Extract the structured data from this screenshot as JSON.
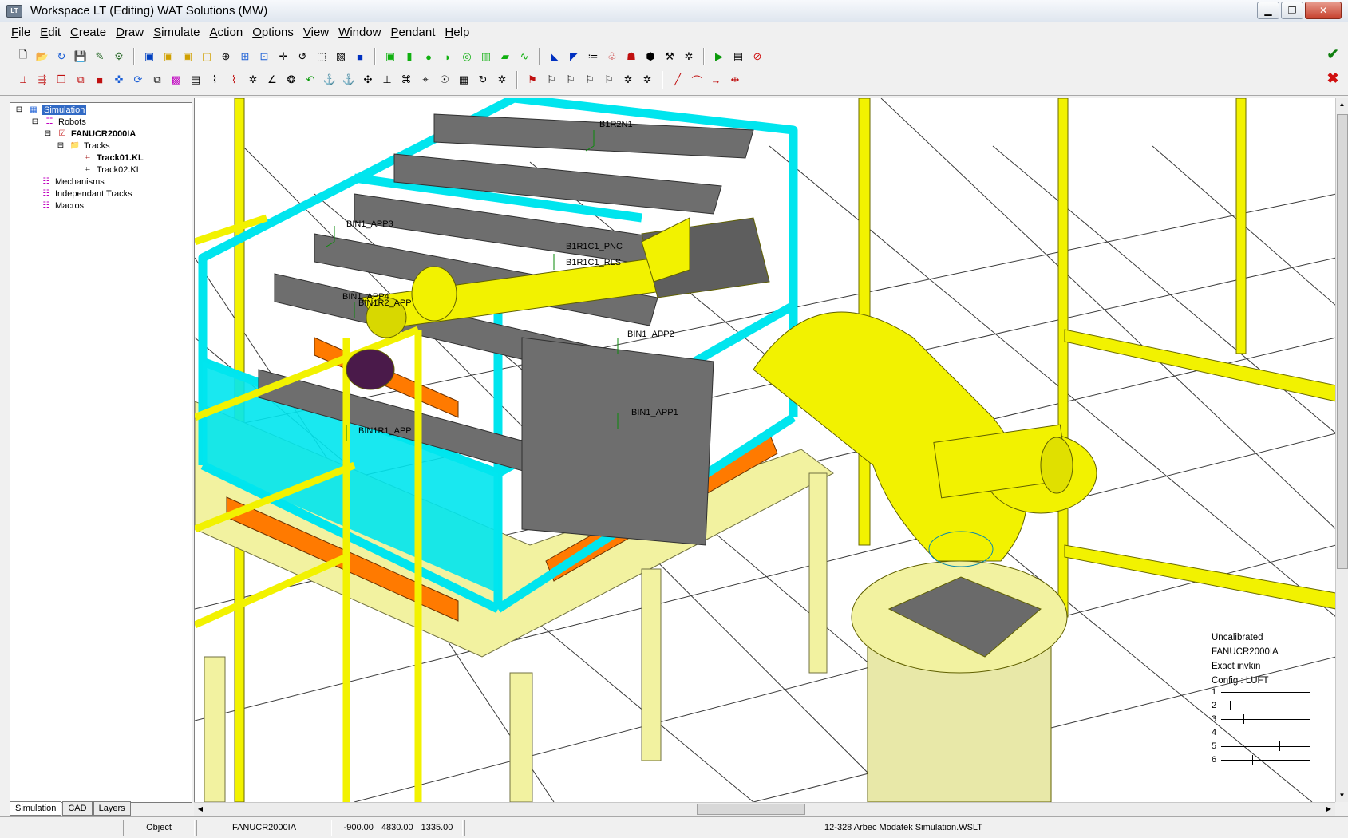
{
  "window": {
    "title": "Workspace LT  (Editing) WAT Solutions (MW)",
    "app_icon": "LT"
  },
  "menu": [
    "File",
    "Edit",
    "Create",
    "Draw",
    "Simulate",
    "Action",
    "Options",
    "View",
    "Window",
    "Pendant",
    "Help"
  ],
  "tree": {
    "root": "Simulation",
    "robots": "Robots",
    "robot": "FANUCR2000IA",
    "tracks": "Tracks",
    "track1": "Track01.KL",
    "track2": "Track02.KL",
    "mechanisms": "Mechanisms",
    "independent": "Independant Tracks",
    "macros": "Macros"
  },
  "tabs": [
    "Simulation",
    "CAD",
    "Layers"
  ],
  "viewport_labels": {
    "b1r2n1": "B1R2N1",
    "bin1_app3": "BIN1_APP3",
    "b1r1c1_pnc": "B1R1C1_PNC",
    "b1r1c1_rls": "B1R1C1_RLS",
    "bin1_app4": "BIN1_APP4",
    "bin1r2_app": "BIN1R2_APP",
    "bin1_app2": "BIN1_APP2",
    "bin1_app1": "BIN1_APP1",
    "bin1r1_app": "BIN1R1_APP"
  },
  "readout": {
    "l1": "Uncalibrated",
    "l2": "FANUCR2000IA",
    "l3": "Exact invkin",
    "l4": "Config : LUFT",
    "joints": [
      {
        "n": "1",
        "pos": 0.33
      },
      {
        "n": "2",
        "pos": 0.1
      },
      {
        "n": "3",
        "pos": 0.25
      },
      {
        "n": "4",
        "pos": 0.6
      },
      {
        "n": "5",
        "pos": 0.65
      },
      {
        "n": "6",
        "pos": 0.35
      }
    ]
  },
  "status": {
    "mode": "Object",
    "robot": "FANUCR2000IA",
    "x": "-900.00",
    "y": "4830.00",
    "z": "1335.00",
    "file": "12-328  Arbec Modatek Simulation.WSLT"
  },
  "colors": {
    "cyan": "#00e5ee",
    "yellow": "#f2f200",
    "orange": "#ff7a00",
    "grey": "#6e6e6e",
    "grid": "#3a3a3a"
  }
}
